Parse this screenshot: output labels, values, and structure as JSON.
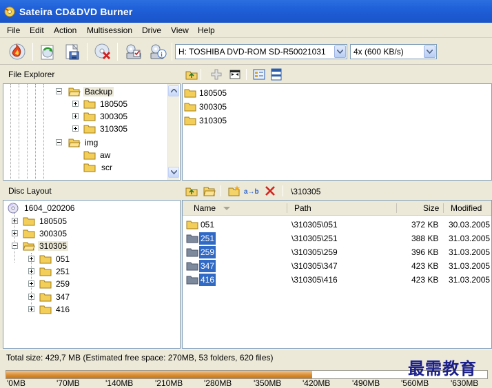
{
  "window": {
    "title": "Sateira CD&DVD Burner"
  },
  "menu": [
    "File",
    "Edit",
    "Action",
    "Multisession",
    "Drive",
    "View",
    "Help"
  ],
  "toolbar": {
    "buttons": [
      "burn-icon",
      "refresh-disc-icon",
      "save-project-icon",
      "erase-disc-icon",
      "drive-properties-icon",
      "disc-info-icon"
    ],
    "drive_value": "H: TOSHIBA DVD-ROM SD-R50021031",
    "speed_value": "4x (600 KB/s)"
  },
  "file_explorer": {
    "label": "File Explorer",
    "tree": [
      {
        "label": "Backup",
        "expanded": true,
        "selected": true
      },
      {
        "label": "180505",
        "expanded": false
      },
      {
        "label": "300305",
        "expanded": false
      },
      {
        "label": "310305",
        "expanded": false
      },
      {
        "label": "img",
        "expanded": true
      },
      {
        "label": "aw"
      },
      {
        "label": "scr"
      }
    ],
    "files": [
      "180505",
      "300305",
      "310305"
    ]
  },
  "disc_layout": {
    "label": "Disc Layout",
    "current_path": "\\310305",
    "tree_root": "1604_020206",
    "tree": [
      {
        "label": "180505",
        "expanded": false
      },
      {
        "label": "300305",
        "expanded": false
      },
      {
        "label": "310305",
        "expanded": true,
        "selected": true
      },
      {
        "label": "051",
        "expanded": false
      },
      {
        "label": "251",
        "expanded": false
      },
      {
        "label": "259",
        "expanded": false
      },
      {
        "label": "347",
        "expanded": false
      },
      {
        "label": "416",
        "expanded": false
      }
    ],
    "columns": [
      "Name",
      "Path",
      "Size",
      "Modified"
    ],
    "rows": [
      {
        "name": "051",
        "path": "\\310305\\051",
        "size": "372 KB",
        "modified": "30.03.2005",
        "selected": false
      },
      {
        "name": "251",
        "path": "\\310305\\251",
        "size": "388 KB",
        "modified": "31.03.2005",
        "selected": true
      },
      {
        "name": "259",
        "path": "\\310305\\259",
        "size": "396 KB",
        "modified": "31.03.2005",
        "selected": true
      },
      {
        "name": "347",
        "path": "\\310305\\347",
        "size": "423 KB",
        "modified": "31.03.2005",
        "selected": true
      },
      {
        "name": "416",
        "path": "\\310305\\416",
        "size": "423 KB",
        "modified": "31.03.2005",
        "selected": true
      }
    ]
  },
  "status": {
    "text": "Total size: 429,7 MB (Estimated free space: 270MB, 53 folders, 620 files)",
    "fill_fraction": 0.636,
    "scale": [
      "'0MB",
      "'70MB",
      "'140MB",
      "'210MB",
      "'280MB",
      "'350MB",
      "'420MB",
      "'490MB",
      "'560MB",
      "'630MB"
    ]
  },
  "watermark": "最需教育",
  "colors": {
    "titlebar": "#1f5fd8",
    "selection": "#316ac5",
    "progress": "#d88a2e"
  }
}
